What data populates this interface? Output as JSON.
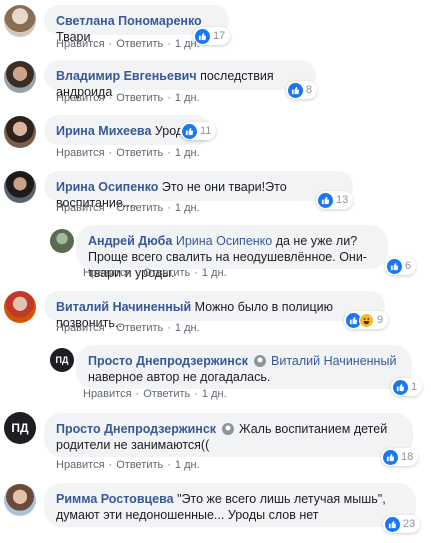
{
  "actions": {
    "like": "Нравится",
    "reply": "Ответить",
    "sep": "·",
    "time": "1 дн."
  },
  "colors": {
    "author": "#385898",
    "bubble": "#f2f3f5",
    "like": "#1877f2"
  },
  "comments": [
    {
      "author": "Светлана Пономаренко",
      "text": "Твари",
      "reactions": "17"
    },
    {
      "author": "Владимир Евгеньевич",
      "text": "последствия андроида",
      "reactions": "8"
    },
    {
      "author": "Ирина Михеева",
      "text": "Уроды",
      "reactions": "11"
    },
    {
      "author": "Ирина Осипенко",
      "text": "Это не они твари!Это воспитание....",
      "reactions": "13"
    },
    {
      "author": "Андрей Дюба",
      "mention": "Ирина Осипенко",
      "text": " да не уже ли? Проще всего свалить на неодушевлённое. Они- твари и уроды.",
      "reactions": "6"
    },
    {
      "author": "Виталий Начиненный",
      "text": "Можно было в полицию позвонить...",
      "reactions": "9"
    },
    {
      "author": "Просто Днепродзержинск",
      "mention": "Виталий Начиненный",
      "text": "наверное автор не догадалась.",
      "reactions": "1",
      "avatar_text": "ПД"
    },
    {
      "author": "Просто Днепродзержинск",
      "text": "Жаль воспитанием детей родители не занимаются((",
      "reactions": "18",
      "avatar_text": "ПД"
    },
    {
      "author": "Римма Ростовцева",
      "text": "\"Это же всего лишь летучая мышь\", думают эти недоношенные... Уроды слов нет",
      "reactions": "23"
    }
  ]
}
